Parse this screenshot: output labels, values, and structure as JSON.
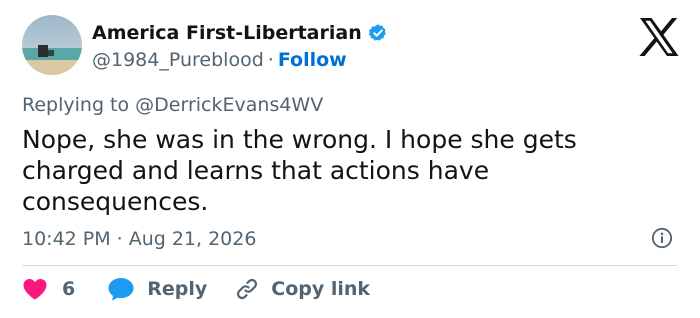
{
  "author": {
    "display_name": "America First-Libertarian",
    "handle": "@1984_Pureblood",
    "follow_label": "Follow",
    "separator": "·"
  },
  "reply": {
    "prefix": "Replying to",
    "mention": "@DerrickEvans4WV"
  },
  "tweet": {
    "text": "Nope, she was in the wrong. I hope she gets charged and learns that actions have consequences."
  },
  "meta": {
    "time": "10:42 PM",
    "separator": "·",
    "date": "Aug 21, 2026"
  },
  "actions": {
    "like_count": "6",
    "reply_label": "Reply",
    "copy_link_label": "Copy link"
  },
  "icons": {
    "verified": "verified-badge-icon",
    "platform": "x-logo-icon",
    "info": "info-icon",
    "like": "heart-icon",
    "reply": "speech-bubble-icon",
    "copy": "link-icon"
  },
  "colors": {
    "verified": "#1d9bf0",
    "follow": "#006fd6",
    "like": "#f91880",
    "reply": "#1d9bf0",
    "secondary_text": "#536471"
  }
}
